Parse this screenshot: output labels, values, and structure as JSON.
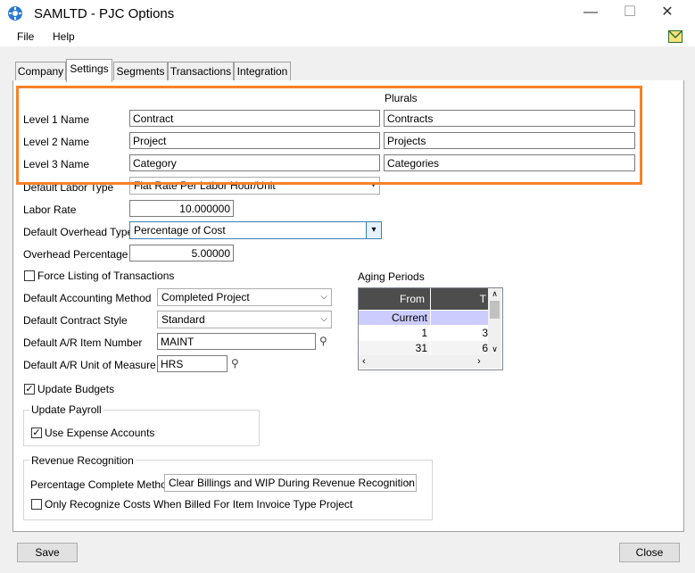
{
  "window": {
    "title": "SAMLTD - PJC Options",
    "controls": {
      "minimize": "—",
      "maximize": "☐",
      "close": "✕"
    }
  },
  "menu": {
    "items": [
      "File",
      "Help"
    ]
  },
  "tabs": [
    {
      "label": "Company"
    },
    {
      "label": "Settings"
    },
    {
      "label": "Segments"
    },
    {
      "label": "Transactions"
    },
    {
      "label": "Integration"
    }
  ],
  "levels": {
    "plurals_header": "Plurals",
    "rows": [
      {
        "label": "Level 1 Name",
        "name": "Contract",
        "plural": "Contracts"
      },
      {
        "label": "Level 2 Name",
        "name": "Project",
        "plural": "Projects"
      },
      {
        "label": "Level 3 Name",
        "name": "Category",
        "plural": "Categories"
      }
    ]
  },
  "labor": {
    "type_label": "Default Labor Type",
    "type_value": "Flat Rate Per Labor Hour/Unit",
    "rate_label": "Labor Rate",
    "rate_value": "10.000000"
  },
  "overhead": {
    "type_label": "Default Overhead Type",
    "type_value": "Percentage of Cost",
    "pct_label": "Overhead Percentage",
    "pct_value": "5.00000"
  },
  "options": {
    "force_listing_label": "Force Listing of Transactions",
    "accounting_method_label": "Default Accounting Method",
    "accounting_method_value": "Completed Project",
    "contract_style_label": "Default Contract Style",
    "contract_style_value": "Standard",
    "ar_item_label": "Default A/R Item Number",
    "ar_item_value": "MAINT",
    "ar_uom_label": "Default A/R Unit of Measure",
    "ar_uom_value": "HRS",
    "update_budgets_label": "Update Budgets"
  },
  "aging": {
    "title": "Aging Periods",
    "header_from": "From",
    "header_to": "T",
    "rows": [
      {
        "from": "Current",
        "to": ""
      },
      {
        "from": "1",
        "to": "3"
      },
      {
        "from": "31",
        "to": "6"
      }
    ]
  },
  "update_payroll": {
    "title": "Update Payroll",
    "use_expense_label": "Use Expense Accounts"
  },
  "revenue": {
    "title": "Revenue Recognition",
    "pct_method_label": "Percentage Complete Method",
    "pct_method_value": "Clear Billings and WIP During Revenue Recognition",
    "only_recognize_label": "Only Recognize Costs When Billed For Item Invoice Type Project"
  },
  "buttons": {
    "save": "Save",
    "close": "Close"
  },
  "colors": {
    "highlight": "#f5822a",
    "grid_header": "#4d4d4d",
    "grid_selected": "#ccccff"
  }
}
